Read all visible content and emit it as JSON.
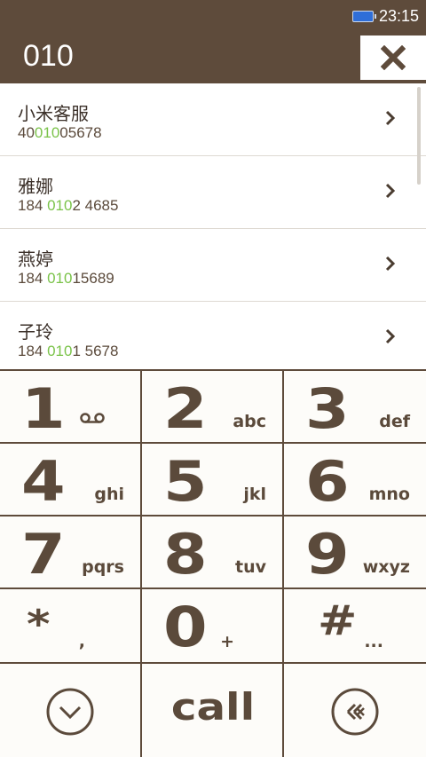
{
  "status_bar": {
    "time": "23:15",
    "battery_icon": "battery-icon"
  },
  "dial": {
    "number": "010",
    "clear_icon": "close-icon"
  },
  "results": [
    {
      "name": "小米客服",
      "pre": "40",
      "match": "010",
      "post": "05678"
    },
    {
      "name": "雅娜",
      "pre": "184 ",
      "match": "010",
      "post": "2 4685"
    },
    {
      "name": "燕婷",
      "pre": "184 ",
      "match": "010",
      "post": "15689"
    },
    {
      "name": "子玲",
      "pre": "184 ",
      "match": "010",
      "post": "1 5678"
    }
  ],
  "keys": [
    {
      "digit": "1",
      "letters": ""
    },
    {
      "digit": "2",
      "letters": "abc"
    },
    {
      "digit": "3",
      "letters": "def"
    },
    {
      "digit": "4",
      "letters": "ghi"
    },
    {
      "digit": "5",
      "letters": "jkl"
    },
    {
      "digit": "6",
      "letters": "mno"
    },
    {
      "digit": "7",
      "letters": "pqrs"
    },
    {
      "digit": "8",
      "letters": "tuv"
    },
    {
      "digit": "9",
      "letters": "wxyz"
    },
    {
      "digit": "*",
      "letters": ","
    },
    {
      "digit": "0",
      "letters": "+"
    },
    {
      "digit": "#",
      "letters": "..."
    }
  ],
  "bottom": {
    "call_label": "call",
    "collapse_icon": "chevron-down-circle-icon",
    "backspace_icon": "backspace-circle-icon"
  },
  "colors": {
    "brand": "#5e4b3b",
    "match_highlight": "#7bc34a"
  }
}
